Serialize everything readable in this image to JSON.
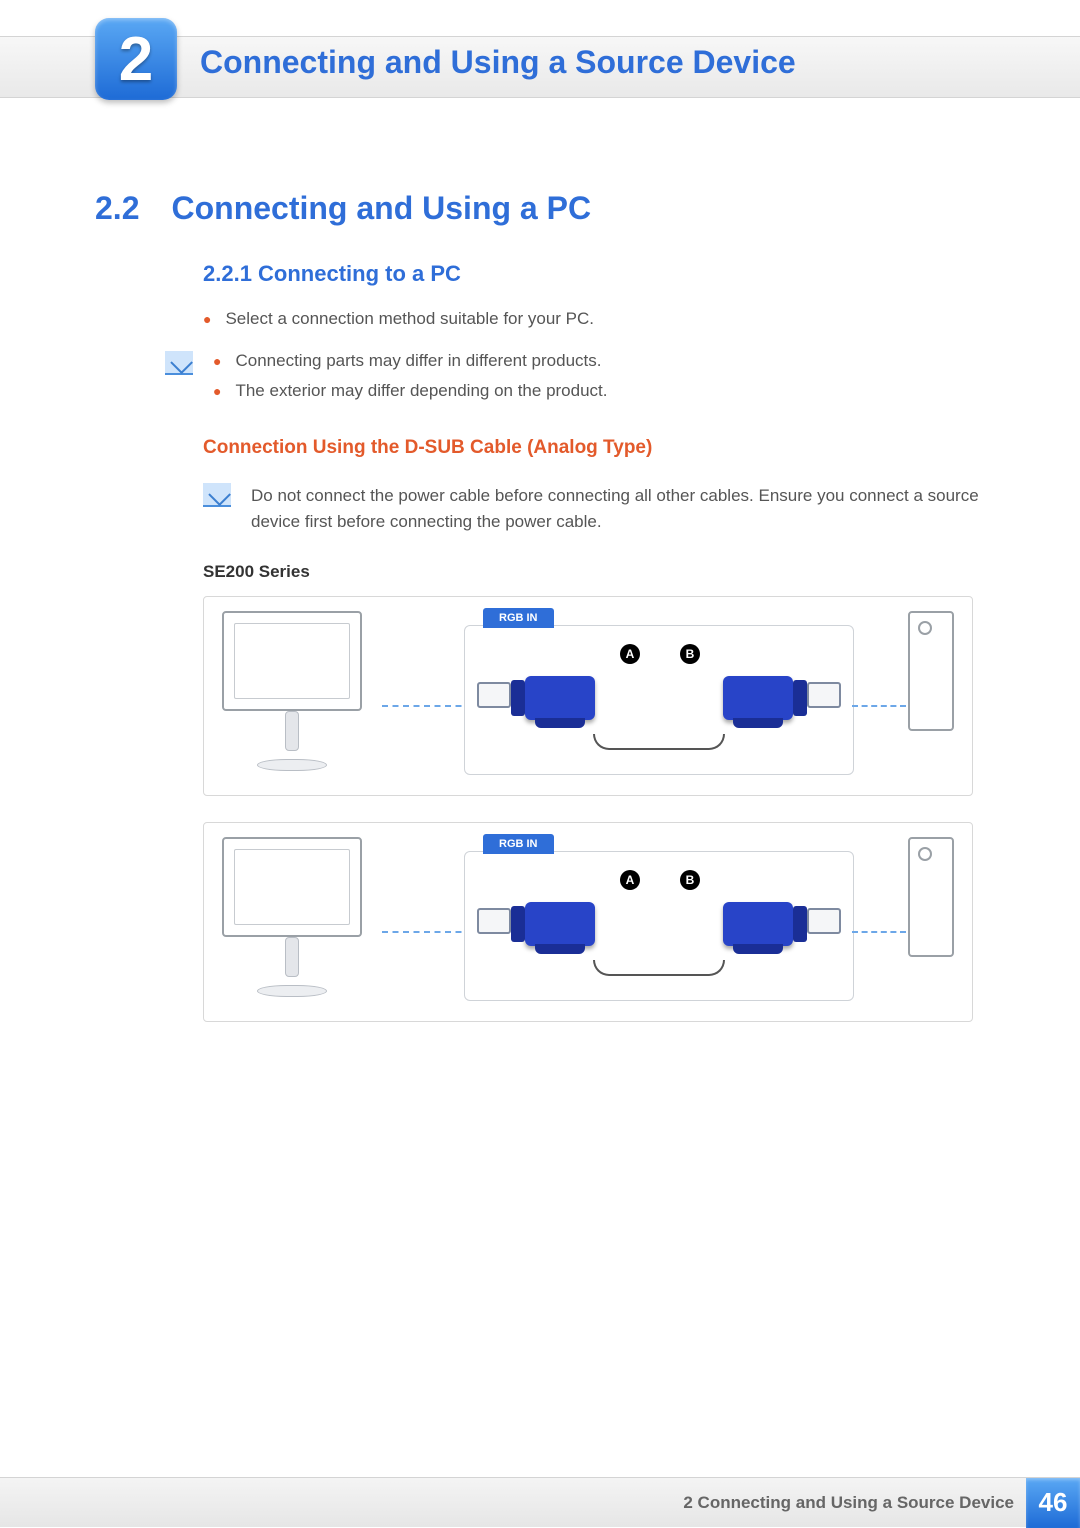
{
  "chapter": {
    "number": "2",
    "title": "Connecting and Using a Source Device"
  },
  "section": {
    "number": "2.2",
    "title": "Connecting and Using a PC"
  },
  "subsection": {
    "number_title": "2.2.1  Connecting to a PC"
  },
  "intro_bullet": "Select a connection method suitable for your PC.",
  "intro_notes": [
    "Connecting parts may differ in different products.",
    "The exterior may differ depending on the product."
  ],
  "dsub": {
    "heading": "Connection Using the D-SUB Cable (Analog Type)",
    "warning": "Do not connect the power cable before connecting all other cables. Ensure you connect a source device first before connecting the power cable.",
    "series_label": "SE200 Series"
  },
  "diagram": {
    "port_label": "RGB IN",
    "badge_a": "A",
    "badge_b": "B"
  },
  "footer": {
    "chapter_ref": "2 Connecting and Using a Source Device",
    "page": "46"
  }
}
